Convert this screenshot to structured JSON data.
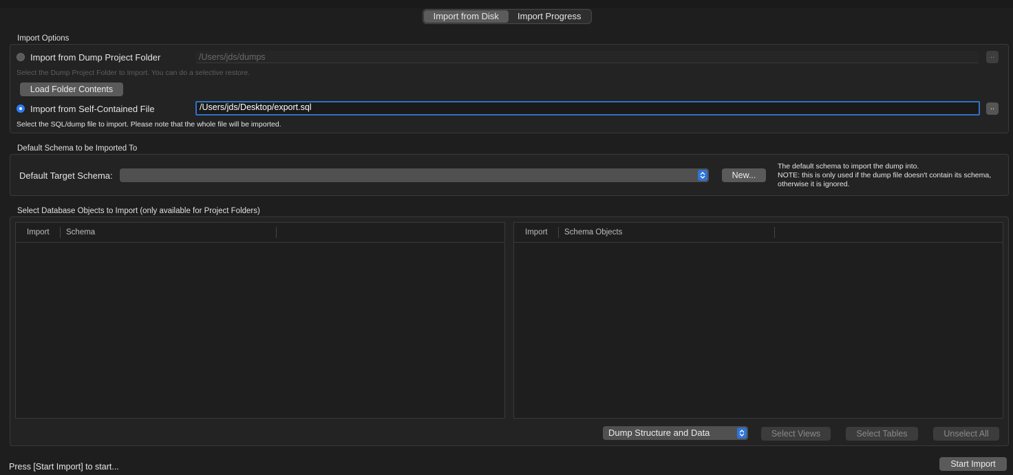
{
  "tabs": [
    {
      "label": "Import from Disk",
      "active": true
    },
    {
      "label": "Import Progress",
      "active": false
    }
  ],
  "import_options": {
    "group_label": "Import Options",
    "dump_folder": {
      "radio_label": "Import from Dump Project Folder",
      "selected": false,
      "path": "/Users/jds/dumps",
      "hint": "Select the Dump Project Folder to Import. You can do a selective restore.",
      "browse_label": ".."
    },
    "load_button": "Load Folder Contents",
    "self_contained": {
      "radio_label": "Import from Self-Contained File",
      "selected": true,
      "path": "/Users/jds/Desktop/export.sql",
      "hint": "Select the SQL/dump file to import. Please note that the whole file will be imported.",
      "browse_label": ".."
    }
  },
  "default_schema": {
    "group_label": "Default Schema to be Imported To",
    "label": "Default Target Schema:",
    "selected_value": "",
    "new_button": "New...",
    "note_lines": [
      "The default schema to import the dump into.",
      "NOTE: this is only used if the dump file doesn't contain its schema,",
      "otherwise it is ignored."
    ]
  },
  "objects": {
    "group_label": "Select Database Objects to Import (only available for Project Folders)",
    "left_table": {
      "columns": [
        "Import",
        "Schema"
      ]
    },
    "right_table": {
      "columns": [
        "Import",
        "Schema Objects"
      ]
    },
    "dump_mode": "Dump Structure and Data",
    "select_views": "Select Views",
    "select_tables": "Select Tables",
    "unselect_all": "Unselect All"
  },
  "status_text": "Press [Start Import] to start...",
  "start_button": "Start Import",
  "colors": {
    "accent": "#2f7cf6",
    "focus_ring": "#2f73c8"
  }
}
